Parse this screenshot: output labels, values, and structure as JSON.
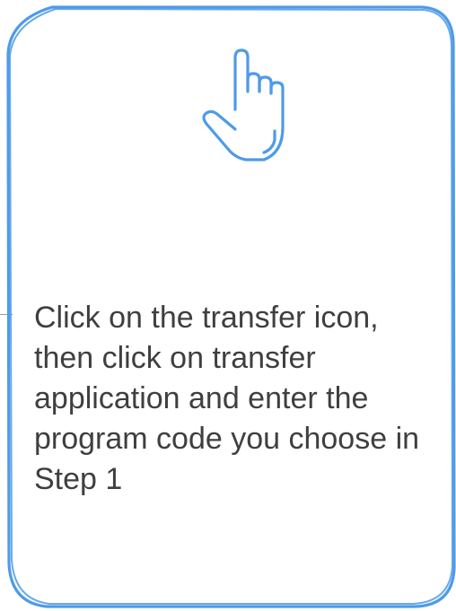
{
  "card": {
    "accent_color": "#4e9be8",
    "text_color": "#3f3f3f",
    "icon": "pointing-hand-icon",
    "instruction": "Click on the transfer icon, then click on transfer application and enter the program code you choose in Step 1"
  }
}
